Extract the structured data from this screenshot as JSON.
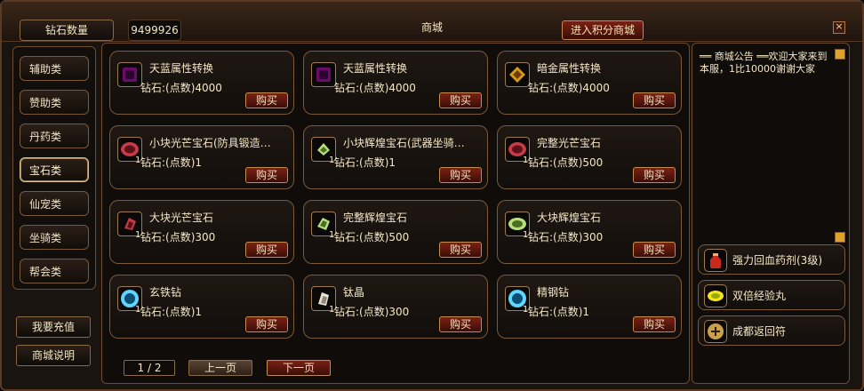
{
  "header": {
    "diamond_label": "钻石数量",
    "diamond_count": "9499926",
    "title": "商城",
    "points_mall_button": "进入积分商城",
    "close_button": "×"
  },
  "left_nav": {
    "items": [
      {
        "label": "辅助类",
        "active": false
      },
      {
        "label": "赞助类",
        "active": false
      },
      {
        "label": "丹药类",
        "active": false
      },
      {
        "label": "宝石类",
        "active": true
      },
      {
        "label": "仙宠类",
        "active": false
      },
      {
        "label": "坐骑类",
        "active": false
      },
      {
        "label": "帮会类",
        "active": false
      }
    ],
    "recharge_button": "我要充值",
    "mall_guide_button": "商城说明"
  },
  "items": [
    {
      "name": "天蓝属性转换",
      "qty": "",
      "price": "钻石:(点数)4000",
      "buy": "购买",
      "icon": "purple-gem-icon",
      "color": "#6b0b6a"
    },
    {
      "name": "天蓝属性转换",
      "qty": "",
      "price": "钻石:(点数)4000",
      "buy": "购买",
      "icon": "purple-gem-icon",
      "color": "#6b0b6a"
    },
    {
      "name": "暗金属性转换",
      "qty": "",
      "price": "钻石:(点数)4000",
      "buy": "购买",
      "icon": "gold-gem-icon",
      "color": "#d79a1d"
    },
    {
      "name": "小块光芒宝石(防具锻造…",
      "qty": "1",
      "price": "钻石:(点数)1",
      "buy": "购买",
      "icon": "red-gem-icon",
      "color": "#c43a47"
    },
    {
      "name": "小块辉煌宝石(武器坐骑…",
      "qty": "1",
      "price": "钻石:(点数)1",
      "buy": "购买",
      "icon": "green-gem-icon",
      "color": "#b6e07b"
    },
    {
      "name": "完整光芒宝石",
      "qty": "1",
      "price": "钻石:(点数)500",
      "buy": "购买",
      "icon": "red-gem-icon",
      "color": "#c43a47"
    },
    {
      "name": "大块光芒宝石",
      "qty": "1",
      "price": "钻石:(点数)300",
      "buy": "购买",
      "icon": "red-gem-icon",
      "color": "#c43a47"
    },
    {
      "name": "完整辉煌宝石",
      "qty": "1",
      "price": "钻石:(点数)500",
      "buy": "购买",
      "icon": "green-gem-icon",
      "color": "#b6e07b"
    },
    {
      "name": "大块辉煌宝石",
      "qty": "1",
      "price": "钻石:(点数)300",
      "buy": "购买",
      "icon": "green-gem-icon",
      "color": "#b6e07b"
    },
    {
      "name": "玄铁钻",
      "qty": "1",
      "price": "钻石:(点数)1",
      "buy": "购买",
      "icon": "blue-gem-icon",
      "color": "#5fd6ff"
    },
    {
      "name": "钛晶",
      "qty": "1",
      "price": "钻石:(点数)300",
      "buy": "购买",
      "icon": "white-crystal-icon",
      "color": "#e8e2d6"
    },
    {
      "name": "精钢钻",
      "qty": "1",
      "price": "钻石:(点数)1",
      "buy": "购买",
      "icon": "blue-gem-icon",
      "color": "#5fd6ff"
    }
  ],
  "pager": {
    "page": "1 / 2",
    "prev": "上一页",
    "next": "下一页"
  },
  "right_panel": {
    "notice": "══ 商城公告 ══欢迎大家来到本服，1比10000谢谢大家",
    "quick_items": [
      {
        "label": "强力回血药剂(3级)",
        "icon": "red-potion-icon"
      },
      {
        "label": "双倍经验丸",
        "icon": "yellow-pill-icon"
      },
      {
        "label": "成都返回符",
        "icon": "scroll-talisman-icon"
      }
    ]
  }
}
